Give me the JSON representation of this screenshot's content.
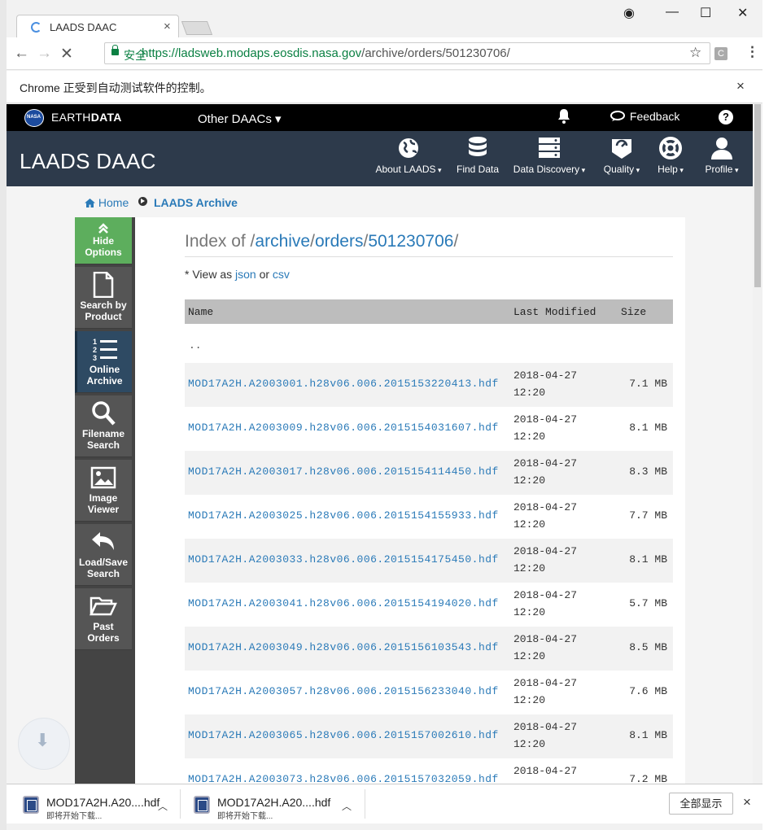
{
  "browser": {
    "tab_title": "LAADS DAAC",
    "tab_close": "×",
    "secure_label": "安全",
    "url_host": "https://ladsweb.modaps.eosdis.nasa.gov",
    "url_path": "/archive/orders/501230706/",
    "ext_label": "C",
    "infobar_text": "Chrome 正受到自动测试软件的控制。",
    "infobar_close": "×",
    "window_controls": {
      "account": "◉",
      "minimize": "—",
      "maximize": "☐",
      "close": "✕"
    },
    "nav_icons": {
      "back": "←",
      "forward": "→",
      "stop": "✕",
      "star": "☆",
      "menu": "⋮"
    }
  },
  "earthdata": {
    "brand_light": "EARTH",
    "brand_bold": "DATA",
    "other_daacs": "Other DAACs ▾",
    "feedback": "Feedback",
    "help": "?"
  },
  "laads": {
    "brand": "LAADS DAAC",
    "nav": [
      "About LAADS",
      "Find Data",
      "Data Discovery",
      "Quality",
      "Help",
      "Profile"
    ]
  },
  "breadcrumb": {
    "home": "Home",
    "current": "LAADS Archive"
  },
  "rail": [
    {
      "label": "Hide Options"
    },
    {
      "label": "Search by Product"
    },
    {
      "label": "Online Archive"
    },
    {
      "label": "Filename Search"
    },
    {
      "label": "Image Viewer"
    },
    {
      "label": "Load/Save Search"
    },
    {
      "label": "Past Orders"
    }
  ],
  "index": {
    "prefix": "Index of /",
    "seg1": "archive",
    "seg2": "orders",
    "seg3": "501230706",
    "sep": "/",
    "view_as": "* View as ",
    "json": "json",
    "or": " or ",
    "csv": "csv",
    "col_name": "Name",
    "col_modified": "Last Modified",
    "col_size": "Size",
    "parent": ".."
  },
  "files": [
    {
      "name": "MOD17A2H.A2003001.h28v06.006.2015153220413.hdf",
      "date": "2018-04-27",
      "time": "12:20",
      "size": "7.1 MB"
    },
    {
      "name": "MOD17A2H.A2003009.h28v06.006.2015154031607.hdf",
      "date": "2018-04-27",
      "time": "12:20",
      "size": "8.1 MB"
    },
    {
      "name": "MOD17A2H.A2003017.h28v06.006.2015154114450.hdf",
      "date": "2018-04-27",
      "time": "12:20",
      "size": "8.3 MB"
    },
    {
      "name": "MOD17A2H.A2003025.h28v06.006.2015154155933.hdf",
      "date": "2018-04-27",
      "time": "12:20",
      "size": "7.7 MB"
    },
    {
      "name": "MOD17A2H.A2003033.h28v06.006.2015154175450.hdf",
      "date": "2018-04-27",
      "time": "12:20",
      "size": "8.1 MB"
    },
    {
      "name": "MOD17A2H.A2003041.h28v06.006.2015154194020.hdf",
      "date": "2018-04-27",
      "time": "12:20",
      "size": "5.7 MB"
    },
    {
      "name": "MOD17A2H.A2003049.h28v06.006.2015156103543.hdf",
      "date": "2018-04-27",
      "time": "12:20",
      "size": "8.5 MB"
    },
    {
      "name": "MOD17A2H.A2003057.h28v06.006.2015156233040.hdf",
      "date": "2018-04-27",
      "time": "12:20",
      "size": "7.6 MB"
    },
    {
      "name": "MOD17A2H.A2003065.h28v06.006.2015157002610.hdf",
      "date": "2018-04-27",
      "time": "12:20",
      "size": "8.1 MB"
    },
    {
      "name": "MOD17A2H.A2003073.h28v06.006.2015157032059.hdf",
      "date": "2018-04-27",
      "time": "",
      "size": "7.2 MB"
    }
  ],
  "downloads": {
    "items": [
      {
        "name": "MOD17A2H.A20....hdf",
        "status": "即将开始下载..."
      },
      {
        "name": "MOD17A2H.A20....hdf",
        "status": "即将开始下载..."
      }
    ],
    "show_all": "全部显示",
    "close": "×"
  }
}
